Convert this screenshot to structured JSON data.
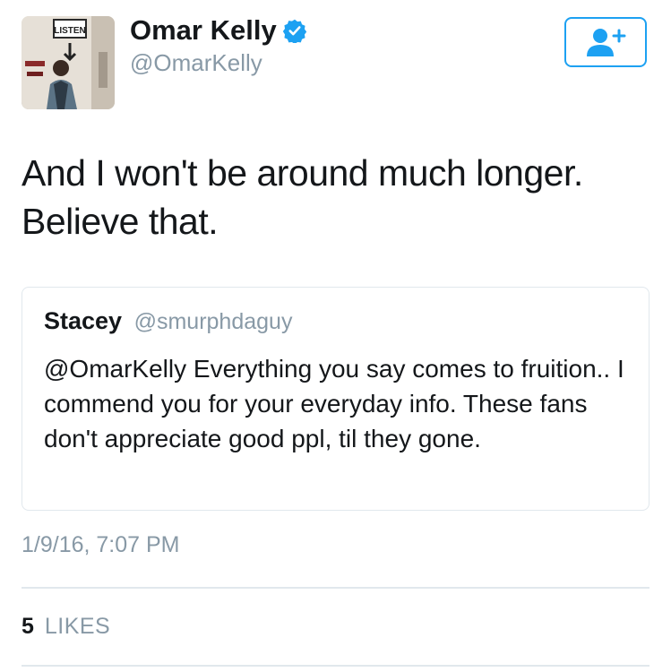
{
  "author": {
    "display_name": "Omar Kelly",
    "handle": "@OmarKelly",
    "verified": true,
    "verified_icon": "verified-badge-icon",
    "avatar_sign_text": "LISTEN"
  },
  "follow_button": {
    "icon": "add-user-icon"
  },
  "tweet": {
    "text": "And I won't be around much longer. Believe that.",
    "timestamp": "1/9/16, 7:07 PM",
    "likes_count": "5",
    "likes_label": "LIKES"
  },
  "quoted_tweet": {
    "name": "Stacey",
    "handle": "@smurphdaguy",
    "text": "@OmarKelly Everything you say comes to fruition.. I commend you for your everyday info. These fans don't appreciate good ppl, til they gone."
  },
  "colors": {
    "accent": "#1da1f2",
    "secondary_text": "#8899a6",
    "border": "#e1e8ed",
    "primary_text": "#14171a"
  }
}
